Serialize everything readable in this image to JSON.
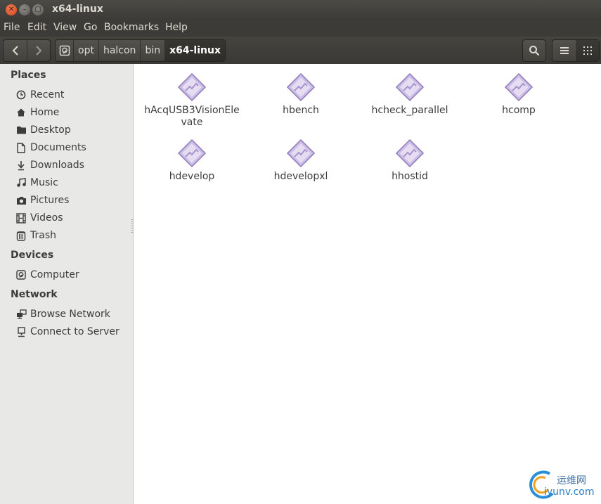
{
  "window": {
    "title": "x64-linux"
  },
  "menu": [
    "File",
    "Edit",
    "View",
    "Go",
    "Bookmarks",
    "Help"
  ],
  "breadcrumb": [
    "opt",
    "halcon",
    "bin",
    "x64-linux"
  ],
  "sidebar": {
    "places_header": "Places",
    "places": [
      {
        "label": "Recent",
        "icon": "clock-icon"
      },
      {
        "label": "Home",
        "icon": "home-icon"
      },
      {
        "label": "Desktop",
        "icon": "folder-icon"
      },
      {
        "label": "Documents",
        "icon": "document-icon"
      },
      {
        "label": "Downloads",
        "icon": "download-icon"
      },
      {
        "label": "Music",
        "icon": "music-icon"
      },
      {
        "label": "Pictures",
        "icon": "camera-icon"
      },
      {
        "label": "Videos",
        "icon": "film-icon"
      },
      {
        "label": "Trash",
        "icon": "trash-icon"
      }
    ],
    "devices_header": "Devices",
    "devices": [
      {
        "label": "Computer",
        "icon": "drive-icon"
      }
    ],
    "network_header": "Network",
    "network": [
      {
        "label": "Browse Network",
        "icon": "network-icon"
      },
      {
        "label": "Connect to Server",
        "icon": "server-icon"
      }
    ]
  },
  "files": [
    {
      "name": "hAcqUSB3VisionEle vate",
      "icon": "executable-icon"
    },
    {
      "name": "hbench",
      "icon": "executable-icon"
    },
    {
      "name": "hcheck_parallel",
      "icon": "executable-icon"
    },
    {
      "name": "hcomp",
      "icon": "executable-icon"
    },
    {
      "name": "hdevelop",
      "icon": "executable-icon"
    },
    {
      "name": "hdevelopxl",
      "icon": "executable-icon"
    },
    {
      "name": "hhostid",
      "icon": "executable-icon"
    }
  ],
  "watermark": {
    "line1": "运维网",
    "line2": "iyunv.com"
  },
  "colors": {
    "titlebar": "#3c3b37",
    "close_button": "#e2572b",
    "sidebar_bg": "#e8e8e7",
    "exec_icon": "#b9a9d8"
  }
}
